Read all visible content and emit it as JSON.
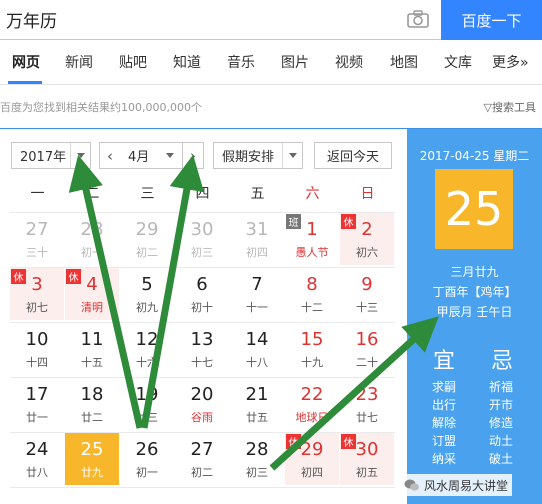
{
  "search": {
    "value": "万年历",
    "button": "百度一下",
    "camera_icon": "camera-icon"
  },
  "tabs": [
    "网页",
    "新闻",
    "贴吧",
    "知道",
    "音乐",
    "图片",
    "视频",
    "地图",
    "文库",
    "更多»"
  ],
  "result_count": "百度为您找到相关结果约100,000,000个",
  "tools": "搜索工具",
  "calendar": {
    "year_select": "2017年",
    "month_select": "4月",
    "holiday_select": "假期安排",
    "today_button": "返回今天",
    "weekdays": [
      "一",
      "二",
      "三",
      "四",
      "五",
      "六",
      "日"
    ],
    "days": [
      {
        "num": "27",
        "lunar": "三十",
        "type": "other"
      },
      {
        "num": "28",
        "lunar": "初一",
        "type": "other"
      },
      {
        "num": "29",
        "lunar": "初二",
        "type": "other"
      },
      {
        "num": "30",
        "lunar": "初三",
        "type": "other"
      },
      {
        "num": "31",
        "lunar": "初四",
        "type": "other"
      },
      {
        "num": "1",
        "lunar": "愚人节",
        "type": "weekend",
        "badge": "班",
        "badge_type": "work",
        "festival": true
      },
      {
        "num": "2",
        "lunar": "初六",
        "type": "holiday",
        "badge": "休",
        "badge_type": "rest"
      },
      {
        "num": "3",
        "lunar": "初七",
        "type": "holiday",
        "badge": "休",
        "badge_type": "rest"
      },
      {
        "num": "4",
        "lunar": "清明",
        "type": "holiday",
        "badge": "休",
        "badge_type": "rest",
        "festival": true
      },
      {
        "num": "5",
        "lunar": "初九"
      },
      {
        "num": "6",
        "lunar": "初十"
      },
      {
        "num": "7",
        "lunar": "十一"
      },
      {
        "num": "8",
        "lunar": "十二",
        "type": "weekend"
      },
      {
        "num": "9",
        "lunar": "十三",
        "type": "weekend"
      },
      {
        "num": "10",
        "lunar": "十四"
      },
      {
        "num": "11",
        "lunar": "十五"
      },
      {
        "num": "12",
        "lunar": "十六"
      },
      {
        "num": "13",
        "lunar": "十七"
      },
      {
        "num": "14",
        "lunar": "十八"
      },
      {
        "num": "15",
        "lunar": "十九",
        "type": "weekend"
      },
      {
        "num": "16",
        "lunar": "二十",
        "type": "weekend"
      },
      {
        "num": "17",
        "lunar": "廿一"
      },
      {
        "num": "18",
        "lunar": "廿二"
      },
      {
        "num": "19",
        "lunar": "廿三"
      },
      {
        "num": "20",
        "lunar": "谷雨",
        "festival": true
      },
      {
        "num": "21",
        "lunar": "廿五"
      },
      {
        "num": "22",
        "lunar": "地球日",
        "type": "weekend",
        "festival": true
      },
      {
        "num": "23",
        "lunar": "廿七",
        "type": "weekend"
      },
      {
        "num": "24",
        "lunar": "廿八"
      },
      {
        "num": "25",
        "lunar": "廿九",
        "type": "today"
      },
      {
        "num": "26",
        "lunar": "初一"
      },
      {
        "num": "27",
        "lunar": "初二"
      },
      {
        "num": "28",
        "lunar": "初三"
      },
      {
        "num": "29",
        "lunar": "初四",
        "type": "holiday",
        "badge": "休",
        "badge_type": "rest"
      },
      {
        "num": "30",
        "lunar": "初五",
        "type": "holiday",
        "badge": "休",
        "badge_type": "rest"
      }
    ]
  },
  "panel": {
    "date_line": "2017-04-25 星期二",
    "big_day": "25",
    "lunar_date": "三月廿九",
    "ganzhi_year": "丁酉年【鸡年】",
    "ganzhi_month_day": "甲辰月 壬午日",
    "yi_title": "宜",
    "ji_title": "忌",
    "yi": [
      "求嗣",
      "出行",
      "解除",
      "订盟",
      "纳采"
    ],
    "ji": [
      "祈福",
      "开市",
      "修造",
      "动土",
      "破土"
    ]
  },
  "watermark": "风水周易大讲堂",
  "colors": {
    "accent": "#3385ff",
    "panel": "#4aa2ee",
    "today": "#f8b62b",
    "holiday_bg": "#fdeeee",
    "red": "#d33",
    "arrow": "#2e8b3a"
  }
}
